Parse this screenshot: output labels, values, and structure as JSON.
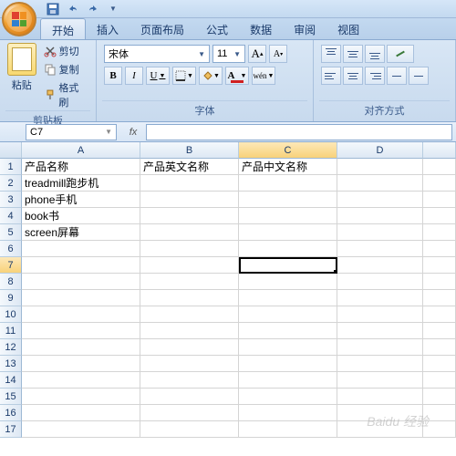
{
  "tabs": {
    "start": "开始",
    "insert": "插入",
    "layout": "页面布局",
    "formula": "公式",
    "data": "数据",
    "review": "审阅",
    "view": "视图"
  },
  "clipboard": {
    "paste": "粘贴",
    "cut": "剪切",
    "copy": "复制",
    "format": "格式刷",
    "label": "剪贴板"
  },
  "font": {
    "name": "宋体",
    "size": "11",
    "label": "字体",
    "b": "B",
    "i": "I",
    "u": "U",
    "wen": "wén"
  },
  "align": {
    "label": "对齐方式"
  },
  "namebox": "C7",
  "headers": {
    "a": "A",
    "b": "B",
    "c": "C",
    "d": "D"
  },
  "rows": [
    "1",
    "2",
    "3",
    "4",
    "5",
    "6",
    "7",
    "8",
    "9",
    "10",
    "11",
    "12",
    "13",
    "14",
    "15",
    "16",
    "17"
  ],
  "cells": {
    "a1": "产品名称",
    "b1": "产品英文名称",
    "c1": "产品中文名称",
    "a2": "treadmill跑步机",
    "a3": "phone手机",
    "a4": "book书",
    "a5": "screen屏幕"
  },
  "watermark": "Baidu 经验"
}
